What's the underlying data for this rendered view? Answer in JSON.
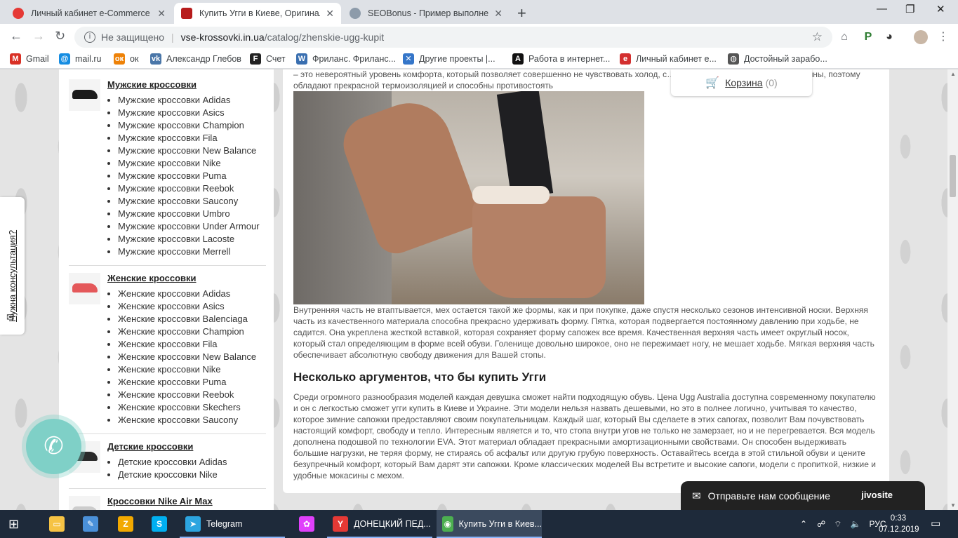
{
  "browser": {
    "tabs": [
      {
        "title": "Личный кабинет e-Commerce P",
        "fav_color": "#e53935",
        "active": false
      },
      {
        "title": "Купить Угги в Киеве, Оригинал",
        "fav_color": "#b71c1c",
        "active": true
      },
      {
        "title": "SEOBonus - Пример выполнения",
        "fav_color": "#8d9baa",
        "active": false
      }
    ],
    "new_tab": "+",
    "address": {
      "security": "Не защищено",
      "host": "vse-krossovki.in.ua",
      "path": "/catalog/zhenskie-ugg-kupit"
    },
    "bookmarks": [
      {
        "label": "Gmail",
        "icon": "gmail-icon",
        "color": "#d93025",
        "glyph": "M"
      },
      {
        "label": "mail.ru",
        "icon": "mailru-icon",
        "color": "#168de2",
        "glyph": "@"
      },
      {
        "label": "ок",
        "icon": "ok-icon",
        "color": "#ee8208",
        "glyph": "ок"
      },
      {
        "label": "Александр Глебов",
        "icon": "vk-icon",
        "color": "#4a76a8",
        "glyph": "vk"
      },
      {
        "label": "Счет",
        "icon": "f-icon",
        "color": "#222222",
        "glyph": "F"
      },
      {
        "label": "Фриланс. Фриланс...",
        "icon": "w-icon",
        "color": "#3a6fb0",
        "glyph": "W"
      },
      {
        "label": "Другие проекты |...",
        "icon": "puzzle-icon",
        "color": "#3576c9",
        "glyph": "✕"
      },
      {
        "label": "Работа в интернет...",
        "icon": "a-icon",
        "color": "#111111",
        "glyph": "A"
      },
      {
        "label": "Личный кабинет е...",
        "icon": "ecom-icon",
        "color": "#d32f2f",
        "glyph": "e"
      },
      {
        "label": "Достойный зарабо...",
        "icon": "globe-icon",
        "color": "#555555",
        "glyph": "◍"
      }
    ]
  },
  "sidebar": {
    "categories": [
      {
        "title": "Мужские кроссовки",
        "shoe_color": "#1b1b1b",
        "items": [
          "Мужские кроссовки Adidas",
          "Мужские кроссовки Asics",
          "Мужские кроссовки Champion",
          "Мужские кроссовки Fila",
          "Мужские кроссовки New Balance",
          "Мужские кроссовки Nike",
          "Мужские кроссовки Puma",
          "Мужские кроссовки Reebok",
          "Мужские кроссовки Saucony",
          "Мужские кроссовки Umbro",
          "Мужские кроссовки Under Armour",
          "Мужские кроссовки Lacoste",
          "Мужские кроссовки Merrell"
        ]
      },
      {
        "title": "Женские кроссовки",
        "shoe_color": "#e4585a",
        "items": [
          "Женские кроссовки Adidas",
          "Женские кроссовки Asics",
          "Женские кроссовки Balenciaga",
          "Женские кроссовки Champion",
          "Женские кроссовки Fila",
          "Женские кроссовки New Balance",
          "Женские кроссовки Nike",
          "Женские кроссовки Puma",
          "Женские кроссовки Reebok",
          "Женские кроссовки Skechers",
          "Женские кроссовки Saucony"
        ]
      },
      {
        "title": "Детские кроссовки",
        "shoe_color": "#2a2a2a",
        "items": [
          "Детские кроссовки Adidas",
          "Детские кроссовки Nike"
        ]
      },
      {
        "title": "Кроссовки Nike Air Max",
        "shoe_color": "#cccccc",
        "items": []
      }
    ]
  },
  "consult": {
    "label": "Нужна консультация?"
  },
  "cart": {
    "label": "Корзина",
    "count": "(0)"
  },
  "content": {
    "intro": "– это невероятный уровень комфорта, который позволяет совершенно не чувствовать холод, с… Угги сделаны из натуральной овчины, поэтому обладают прекрасной термоизоляцией и способны противостоять",
    "p1": "Внутренняя часть не втаптывается, мех остается такой же формы, как и при покупке, даже спустя несколько сезонов интенсивной носки. Верхняя часть из качественного материала способна прекрасно удерживать форму. Пятка, которая подвергается постоянному давлению при ходьбе, не садится. Она укреплена жесткой вставкой, которая сохраняет форму сапожек все время. Качественная верхняя часть имеет округлый носок, который стал определяющим в форме всей обуви. Голенище довольно широкое, оно не пережимает ногу, не мешает ходьбе. Мягкая верхняя часть обеспечивает абсолютную свободу движения для Вашей стопы.",
    "heading": "Несколько аргументов, что бы купить Угги",
    "p2": "Среди огромного разнообразия моделей каждая девушка сможет найти подходящую обувь. Цена Ugg Australia доступна современному покупателю и он с легкостью сможет угги купить в Киеве и Украине. Эти модели нельзя назвать дешевыми, но это в полнее логично, учитывая то качество, которое зимние сапожки предоставляют своим покупательницам. Каждый шаг, который Вы сделаете в этих сапогах, позволит Вам почувствовать настоящий комфорт, свободу и тепло. Интересным является и то, что стопа внутри угов не только не замерзает, но и не перегревается. Вся модель дополнена подошвой по технологии EVA. Этот материал обладает прекрасными амортизационными свойствами. Он способен выдерживать большие нагрузки, не теряя форму, не стираясь об асфальт или другую грубую поверхность. Оставайтесь всегда в этой стильной обуви и цените безупречный комфорт, который Вам дарят эти сапожки. Кроме классических моделей Вы встретите и высокие сапоги, модели с пропиткой, низкие и удобные мокасины с мехом."
  },
  "chat": {
    "label": "Отправьте нам сообщение",
    "brand": "jivosite"
  },
  "taskbar": {
    "items": [
      {
        "label": "",
        "icon": "explorer-icon",
        "color": "#f6c344",
        "glyph": "▭"
      },
      {
        "label": "",
        "icon": "paint-icon",
        "color": "#4a90d9",
        "glyph": "✎"
      },
      {
        "label": "",
        "icon": "z-app-icon",
        "color": "#f2a900",
        "glyph": "Z"
      },
      {
        "label": "",
        "icon": "skype-icon",
        "color": "#00aff0",
        "glyph": "S"
      },
      {
        "label": "Telegram",
        "icon": "telegram-icon",
        "color": "#2ca5e0",
        "glyph": "➤"
      },
      {
        "label": "",
        "icon": "colorful-app-icon",
        "color": "#e040fb",
        "glyph": "✿"
      },
      {
        "label": "ДОНЕЦКИЙ ПЕД...",
        "icon": "yandex-icon",
        "color": "#e53935",
        "glyph": "Y"
      },
      {
        "label": "Купить Угги в Киев...",
        "icon": "chrome-icon",
        "color": "#4caf50",
        "glyph": "◉"
      }
    ],
    "lang": "РУС",
    "time": "0:33",
    "date": "07.12.2019"
  }
}
